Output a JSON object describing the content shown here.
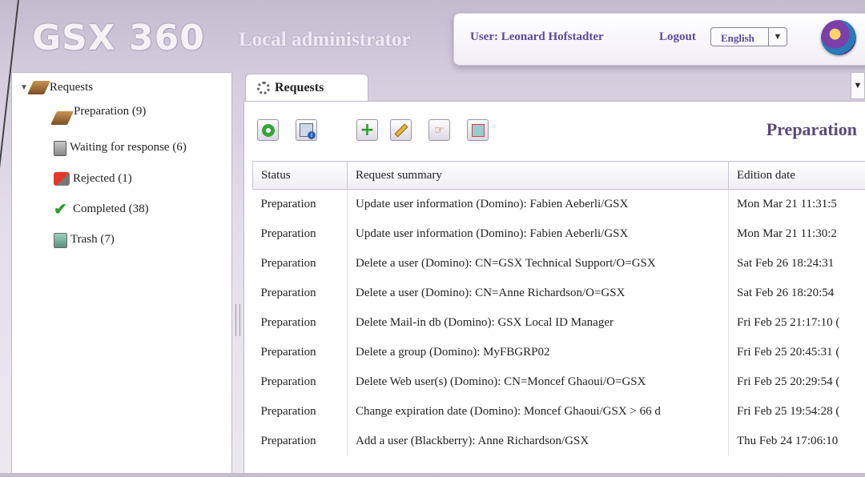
{
  "header": {
    "logo": "GSX 360",
    "subtitle": "Local administrator",
    "user_label": "User: Leonard Hofstadter",
    "logout": "Logout",
    "language": "English"
  },
  "tree": {
    "root": "Requests",
    "items": [
      {
        "label": "Preparation (9)",
        "icon": "box-icon"
      },
      {
        "label": "Waiting for response (6)",
        "icon": "hourglass-icon"
      },
      {
        "label": "Rejected (1)",
        "icon": "reject-icon"
      },
      {
        "label": "Completed (38)",
        "icon": "check-icon"
      },
      {
        "label": "Trash (7)",
        "icon": "trash-icon"
      }
    ]
  },
  "tabs": [
    {
      "label": "Requests"
    }
  ],
  "panel": {
    "title": "Preparation",
    "columns": [
      "Status",
      "Request summary",
      "Edition date"
    ],
    "rows": [
      [
        "Preparation",
        "Update user information (Domino): Fabien Aeberli/GSX",
        "Mon Mar 21 11:31:5"
      ],
      [
        "Preparation",
        "Update user information (Domino): Fabien Aeberli/GSX",
        "Mon Mar 21 11:30:2"
      ],
      [
        "Preparation",
        "Delete a user (Domino): CN=GSX Technical Support/O=GSX",
        "Sat Feb 26 18:24:31"
      ],
      [
        "Preparation",
        "Delete a user (Domino): CN=Anne Richardson/O=GSX",
        "Sat Feb 26 18:20:54"
      ],
      [
        "Preparation",
        "Delete Mail-in db (Domino): GSX Local ID Manager",
        "Fri Feb 25 21:17:10 ("
      ],
      [
        "Preparation",
        "Delete a group (Domino): MyFBGRP02",
        "Fri Feb 25 20:45:31 ("
      ],
      [
        "Preparation",
        "Delete Web user(s) (Domino): CN=Moncef Ghaoui/O=GSX",
        "Fri Feb 25 20:29:54 ("
      ],
      [
        "Preparation",
        "Change expiration date (Domino): Moncef Ghaoui/GSX > 66 d",
        "Fri Feb 25 19:54:28 ("
      ],
      [
        "Preparation",
        "Add a user (Blackberry): Anne Richardson/GSX",
        "Thu Feb 24 17:06:10"
      ]
    ]
  }
}
